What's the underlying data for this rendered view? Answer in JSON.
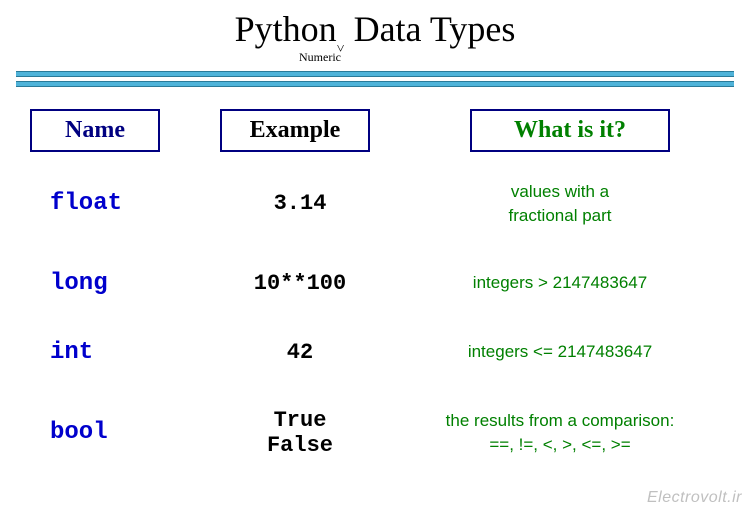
{
  "title": {
    "left": "Python",
    "caret": "˅",
    "right": " Data Types",
    "subtitle": "Numeric"
  },
  "headers": {
    "name": "Name",
    "example": "Example",
    "what": "What is it?"
  },
  "rows": [
    {
      "name": "float",
      "example": "3.14",
      "desc": "values with a\nfractional part"
    },
    {
      "name": "long",
      "example": "10**100",
      "desc": "integers > 2147483647"
    },
    {
      "name": "int",
      "example": "42",
      "desc": "integers <= 2147483647"
    },
    {
      "name": "bool",
      "example": "True\nFalse",
      "desc": "the results from a comparison:\n==,  !=,  <, >,  <=,  >="
    }
  ],
  "watermark": "Electrovolt.ir"
}
